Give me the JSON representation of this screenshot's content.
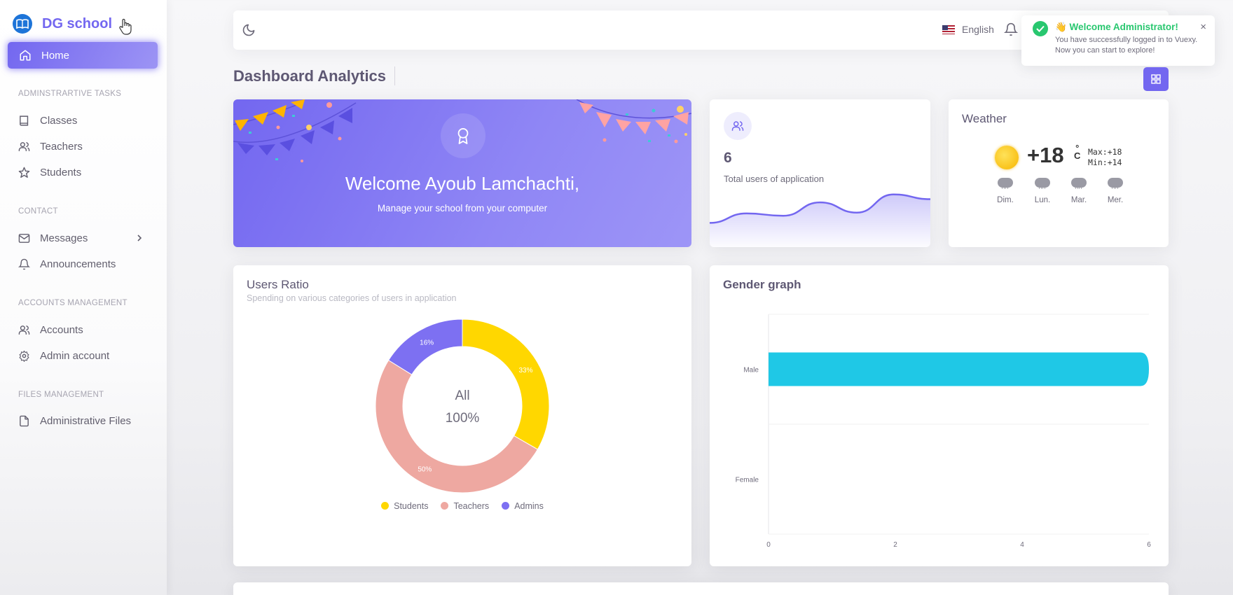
{
  "brand": {
    "name": "DG school"
  },
  "sidebar": {
    "home_label": "Home",
    "sections": [
      {
        "title": "ADMINSTRARTIVE TASKS",
        "items": [
          "Classes",
          "Teachers",
          "Students"
        ]
      },
      {
        "title": "CONTACT",
        "items": [
          "Messages",
          "Announcements"
        ]
      },
      {
        "title": "ACCOUNTS MANAGEMENT",
        "items": [
          "Accounts",
          "Admin account"
        ]
      },
      {
        "title": "FILES MANAGEMENT",
        "items": [
          "Administrative Files"
        ]
      }
    ]
  },
  "navbar": {
    "language": "English"
  },
  "toast": {
    "title": "👋 Welcome Administrator!",
    "body": "You have successfully logged in to Vuexy. Now you can start to explore!",
    "close": "×"
  },
  "page": {
    "title": "Dashboard Analytics"
  },
  "welcome": {
    "title": "Welcome Ayoub Lamchachti,",
    "subtitle": "Manage your school from your computer"
  },
  "users_card": {
    "count": "6",
    "label": "Total users of application"
  },
  "weather": {
    "title": "Weather",
    "temp": "+18",
    "unit_top": "°",
    "unit_bottom": "C",
    "max": "Max:+18",
    "min": "Min:+14",
    "days": [
      "Dim.",
      "Lun.",
      "Mar.",
      "Mer."
    ]
  },
  "ratio": {
    "title": "Users Ratio",
    "subtitle": "Spending on various categories of users in application",
    "center_label": "All",
    "center_value": "100%"
  },
  "gender": {
    "title": "Gender graph"
  },
  "colors": {
    "primary": "#7367f0",
    "success": "#28c76f",
    "students": "#ffd700",
    "teachers": "#eea8a1",
    "admins": "#7d70f2",
    "gender_bar": "#1fc8e6"
  },
  "chart_data": [
    {
      "type": "pie",
      "title": "Users Ratio",
      "categories": [
        "Students",
        "Teachers",
        "Admins"
      ],
      "values": [
        33,
        50,
        16
      ],
      "labels": [
        "33%",
        "50%",
        "16%"
      ]
    },
    {
      "type": "bar",
      "orientation": "horizontal",
      "title": "Gender graph",
      "categories": [
        "Male",
        "Female"
      ],
      "values": [
        6,
        0
      ],
      "xlim": [
        0,
        6
      ],
      "x_ticks": [
        "0",
        "2",
        "4",
        "6"
      ],
      "grid": true
    },
    {
      "type": "area",
      "title": "",
      "values": [
        2,
        3.2,
        2.9,
        4.6,
        3.3,
        5.6,
        5.0
      ]
    }
  ]
}
